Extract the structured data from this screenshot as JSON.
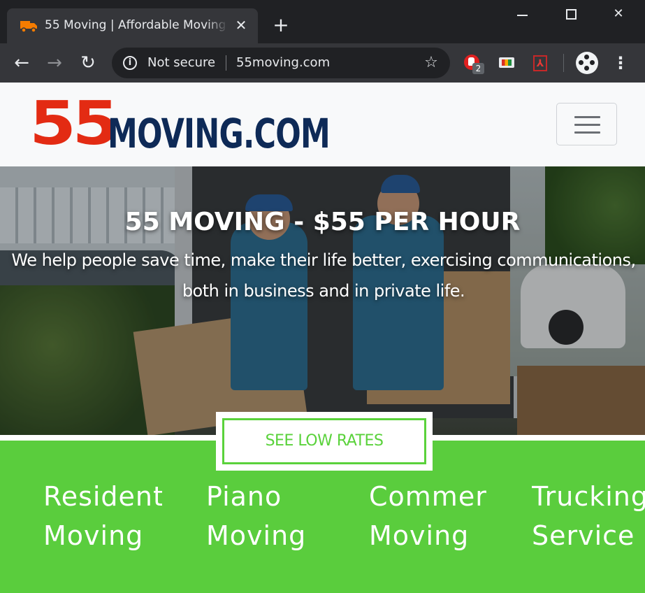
{
  "browser": {
    "tab": {
      "title": "55 Moving | Affordable Moving C",
      "close_glyph": "✕",
      "favicon": "moving-truck-icon"
    },
    "new_tab_glyph": "+",
    "window_controls": {
      "close_glyph": "✕"
    },
    "toolbar": {
      "back_glyph": "←",
      "forward_glyph": "→",
      "reload_glyph": "↻",
      "security_label": "Not secure",
      "info_glyph": "i",
      "url": "55moving.com",
      "star_glyph": "☆",
      "extensions": [
        {
          "name": "adblock-icon",
          "badge": "2"
        },
        {
          "name": "cast-icon"
        },
        {
          "name": "pdf-icon",
          "glyph": "⅄"
        }
      ],
      "menu_glyph": "⋮"
    }
  },
  "site": {
    "logo": {
      "number": "55",
      "name": "MOVING.COM"
    },
    "colors": {
      "logo_red": "#e32b13",
      "logo_navy": "#0e2a57",
      "accent_green": "#5acd3d"
    }
  },
  "hero": {
    "title": "55 MOVING - $55 PER HOUR",
    "text": "We help people save time, make their life better, exercising communications, both in business and in private life.",
    "cta": "SEE LOW RATES"
  },
  "services": [
    {
      "line1": "Residential",
      "line2": "Moving"
    },
    {
      "line1": "Piano",
      "line2": "Moving"
    },
    {
      "line1": "Commercial",
      "line2": "Moving"
    },
    {
      "line1": "Trucking",
      "line2": "Service"
    }
  ]
}
